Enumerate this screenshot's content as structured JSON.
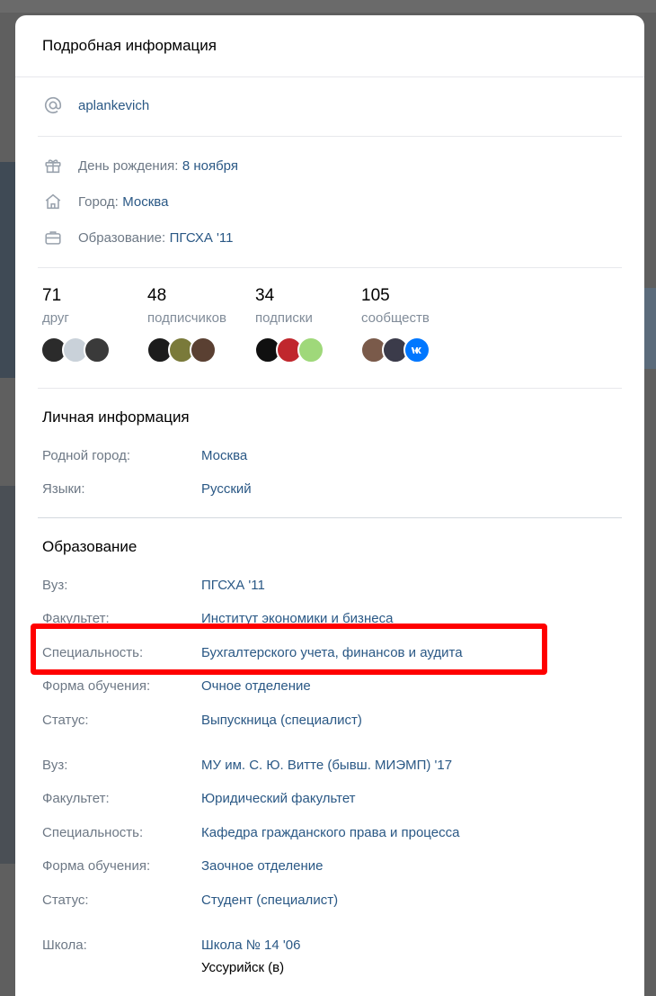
{
  "modal": {
    "title": "Подробная информация"
  },
  "profile": {
    "username": "aplankevich",
    "birthday_label": "День рождения:",
    "birthday_value": "8 ноября",
    "city_label": "Город:",
    "city_value": "Москва",
    "education_label": "Образование:",
    "education_value": "ПГСХА '11"
  },
  "counters": [
    {
      "number": "71",
      "label": "друг",
      "avatars": [
        "#2b2b2b",
        "#c9d1d9",
        "#3a3a3a"
      ]
    },
    {
      "number": "48",
      "label": "подписчиков",
      "avatars": [
        "#1c1c1c",
        "#7a7a3a",
        "#5a4032"
      ]
    },
    {
      "number": "34",
      "label": "подписки",
      "avatars": [
        "#101010",
        "#c0272d",
        "#9fd87a"
      ]
    },
    {
      "number": "105",
      "label": "сообществ",
      "avatars": [
        "#7a5a4a",
        "#3b3b4a",
        "#0077ff"
      ]
    }
  ],
  "personal": {
    "title": "Личная информация",
    "rows": [
      {
        "label": "Родной город:",
        "value": "Москва"
      },
      {
        "label": "Языки:",
        "value": "Русский"
      }
    ]
  },
  "education": {
    "title": "Образование",
    "uni1": [
      {
        "label": "Вуз:",
        "value": "ПГСХА '11"
      },
      {
        "label": "Факультет:",
        "value": "Институт экономики и бизнеса"
      },
      {
        "label": "Специальность:",
        "value": "Бухгалтерского учета, финансов и аудита"
      },
      {
        "label": "Форма обучения:",
        "value": "Очное отделение"
      },
      {
        "label": "Статус:",
        "value": "Выпускница (специалист)"
      }
    ],
    "uni2": [
      {
        "label": "Вуз:",
        "value": "МУ им. С. Ю. Витте (бывш. МИЭМП) '17"
      },
      {
        "label": "Факультет:",
        "value": "Юридический факультет"
      },
      {
        "label": "Специальность:",
        "value": "Кафедра гражданского права и процесса"
      },
      {
        "label": "Форма обучения:",
        "value": "Заочное отделение"
      },
      {
        "label": "Статус:",
        "value": "Студент (специалист)"
      }
    ],
    "school": {
      "label": "Школа:",
      "value": "Школа № 14 '06",
      "city": "Уссурийск (в)"
    }
  },
  "colors": {
    "link": "#2a5885",
    "label": "#6d7885",
    "highlight": "#ff0000"
  }
}
